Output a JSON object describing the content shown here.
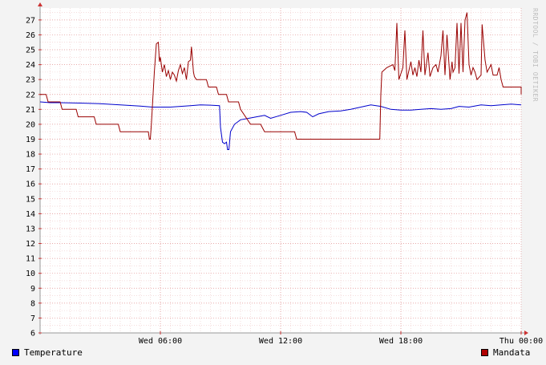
{
  "chart_data": {
    "type": "line",
    "title": "",
    "xlabel": "",
    "ylabel": "",
    "ylim": [
      6,
      27.8
    ],
    "xlim": [
      0,
      24
    ],
    "y_ticks": [
      6,
      7,
      8,
      9,
      10,
      11,
      12,
      13,
      14,
      15,
      16,
      17,
      18,
      19,
      20,
      21,
      22,
      23,
      24,
      25,
      26,
      27
    ],
    "x_ticks": [
      {
        "value": 6,
        "label": "Wed 06:00"
      },
      {
        "value": 12,
        "label": "Wed 12:00"
      },
      {
        "value": 18,
        "label": "Wed 18:00"
      },
      {
        "value": 24,
        "label": "Thu 00:00"
      }
    ],
    "grid": true,
    "legend_position": "bottom",
    "watermark": "RRDTOOL / TOBI OETIKER",
    "series": [
      {
        "name": "Temperature",
        "color": "#0000cc",
        "points": [
          [
            0,
            21.5
          ],
          [
            0.5,
            21.45
          ],
          [
            1,
            21.45
          ],
          [
            2,
            21.42
          ],
          [
            3,
            21.38
          ],
          [
            4,
            21.3
          ],
          [
            5,
            21.22
          ],
          [
            5.6,
            21.15
          ],
          [
            6.5,
            21.15
          ],
          [
            7,
            21.2
          ],
          [
            7.5,
            21.25
          ],
          [
            8,
            21.3
          ],
          [
            8.5,
            21.28
          ],
          [
            8.95,
            21.25
          ],
          [
            9.0,
            19.8
          ],
          [
            9.1,
            18.8
          ],
          [
            9.2,
            18.7
          ],
          [
            9.3,
            18.8
          ],
          [
            9.35,
            18.3
          ],
          [
            9.42,
            18.3
          ],
          [
            9.5,
            19.5
          ],
          [
            9.7,
            20.0
          ],
          [
            10,
            20.3
          ],
          [
            10.4,
            20.4
          ],
          [
            10.8,
            20.5
          ],
          [
            11.2,
            20.6
          ],
          [
            11.5,
            20.4
          ],
          [
            12,
            20.6
          ],
          [
            12.5,
            20.8
          ],
          [
            13,
            20.85
          ],
          [
            13.3,
            20.8
          ],
          [
            13.6,
            20.5
          ],
          [
            13.9,
            20.7
          ],
          [
            14.4,
            20.85
          ],
          [
            15,
            20.9
          ],
          [
            15.5,
            21.0
          ],
          [
            16,
            21.15
          ],
          [
            16.5,
            21.3
          ],
          [
            17,
            21.2
          ],
          [
            17.5,
            21.0
          ],
          [
            18,
            20.95
          ],
          [
            18.5,
            20.95
          ],
          [
            19,
            21.0
          ],
          [
            19.5,
            21.05
          ],
          [
            20,
            21.0
          ],
          [
            20.5,
            21.05
          ],
          [
            20.9,
            21.2
          ],
          [
            21.4,
            21.15
          ],
          [
            22,
            21.3
          ],
          [
            22.5,
            21.25
          ],
          [
            23,
            21.3
          ],
          [
            23.5,
            21.35
          ],
          [
            24,
            21.3
          ]
        ]
      },
      {
        "name": "Mandata",
        "color": "#990000",
        "points": [
          [
            0,
            22.0
          ],
          [
            0.3,
            22.0
          ],
          [
            0.4,
            21.5
          ],
          [
            1,
            21.5
          ],
          [
            1.1,
            21.0
          ],
          [
            1.8,
            21.0
          ],
          [
            1.9,
            20.5
          ],
          [
            2.7,
            20.5
          ],
          [
            2.8,
            20.0
          ],
          [
            3.9,
            20.0
          ],
          [
            4.0,
            19.5
          ],
          [
            5.4,
            19.5
          ],
          [
            5.45,
            19.0
          ],
          [
            5.5,
            19.0
          ],
          [
            5.55,
            20.0
          ],
          [
            5.7,
            23.5
          ],
          [
            5.8,
            25.4
          ],
          [
            5.9,
            25.5
          ],
          [
            5.95,
            24.2
          ],
          [
            6.0,
            24.5
          ],
          [
            6.1,
            23.5
          ],
          [
            6.2,
            24.0
          ],
          [
            6.3,
            23.2
          ],
          [
            6.4,
            23.6
          ],
          [
            6.5,
            23.0
          ],
          [
            6.6,
            23.5
          ],
          [
            6.7,
            23.3
          ],
          [
            6.8,
            22.9
          ],
          [
            6.9,
            23.6
          ],
          [
            7.0,
            24.0
          ],
          [
            7.1,
            23.4
          ],
          [
            7.2,
            23.8
          ],
          [
            7.3,
            23.0
          ],
          [
            7.4,
            24.2
          ],
          [
            7.5,
            24.3
          ],
          [
            7.55,
            25.2
          ],
          [
            7.65,
            23.5
          ],
          [
            7.7,
            23.2
          ],
          [
            7.8,
            23.0
          ],
          [
            8.3,
            23.0
          ],
          [
            8.4,
            22.5
          ],
          [
            8.8,
            22.5
          ],
          [
            8.9,
            22.0
          ],
          [
            9.3,
            22.0
          ],
          [
            9.4,
            21.5
          ],
          [
            9.9,
            21.5
          ],
          [
            10.0,
            21.0
          ],
          [
            10.5,
            20.0
          ],
          [
            11,
            20.0
          ],
          [
            11.2,
            19.5
          ],
          [
            12.7,
            19.5
          ],
          [
            12.8,
            19.0
          ],
          [
            16.95,
            19.0
          ],
          [
            17.0,
            22.0
          ],
          [
            17.05,
            23.5
          ],
          [
            17.3,
            23.8
          ],
          [
            17.6,
            24.0
          ],
          [
            17.7,
            23.6
          ],
          [
            17.8,
            26.8
          ],
          [
            17.9,
            23.0
          ],
          [
            18.1,
            23.8
          ],
          [
            18.2,
            26.3
          ],
          [
            18.3,
            23.0
          ],
          [
            18.5,
            24.2
          ],
          [
            18.6,
            23.3
          ],
          [
            18.7,
            23.8
          ],
          [
            18.8,
            23.2
          ],
          [
            18.9,
            24.3
          ],
          [
            19.0,
            23.5
          ],
          [
            19.1,
            26.3
          ],
          [
            19.2,
            23.3
          ],
          [
            19.35,
            24.8
          ],
          [
            19.45,
            23.2
          ],
          [
            19.6,
            23.8
          ],
          [
            19.75,
            24.0
          ],
          [
            19.85,
            23.5
          ],
          [
            20.0,
            24.6
          ],
          [
            20.1,
            26.3
          ],
          [
            20.2,
            23.3
          ],
          [
            20.3,
            26.0
          ],
          [
            20.45,
            23.0
          ],
          [
            20.55,
            24.2
          ],
          [
            20.6,
            23.5
          ],
          [
            20.7,
            23.8
          ],
          [
            20.8,
            26.8
          ],
          [
            20.9,
            23.4
          ],
          [
            21.0,
            26.8
          ],
          [
            21.1,
            23.5
          ],
          [
            21.2,
            27.0
          ],
          [
            21.3,
            27.5
          ],
          [
            21.4,
            24.0
          ],
          [
            21.5,
            23.3
          ],
          [
            21.6,
            23.8
          ],
          [
            21.7,
            23.5
          ],
          [
            21.8,
            23.0
          ],
          [
            22.0,
            23.3
          ],
          [
            22.05,
            26.7
          ],
          [
            22.2,
            24.3
          ],
          [
            22.3,
            23.5
          ],
          [
            22.5,
            24.0
          ],
          [
            22.6,
            23.3
          ],
          [
            22.8,
            23.3
          ],
          [
            22.9,
            23.8
          ],
          [
            23.0,
            23.0
          ],
          [
            23.1,
            22.5
          ],
          [
            24.0,
            22.5
          ],
          [
            24.05,
            22.0
          ],
          [
            25.5,
            22.0
          ]
        ]
      }
    ]
  },
  "legend": {
    "temperature_label": "Temperature",
    "mandata_label": "Mandata"
  }
}
